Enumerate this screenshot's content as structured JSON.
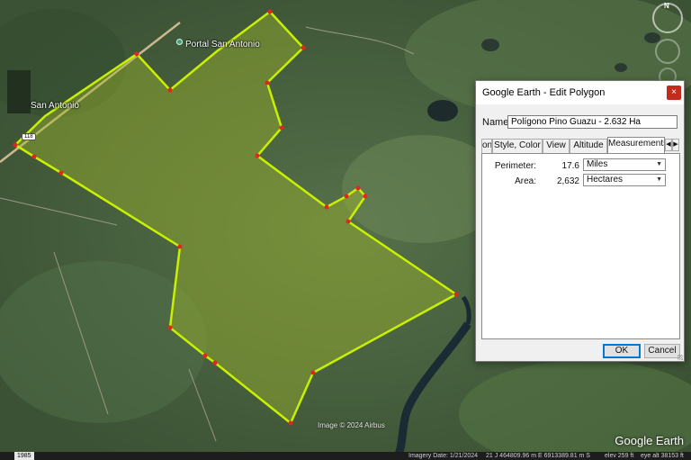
{
  "map": {
    "place_labels": {
      "town": "San Antonio",
      "poi": "Portal San Antonio"
    },
    "route_shield": "118",
    "imagery_credit": "Image © 2024 Airbus",
    "brand": "Google Earth",
    "compass_north": "N",
    "colors": {
      "polygon_fill": "#9fb82a",
      "polygon_outline": "#c8f000",
      "vertex": "#e3261b"
    }
  },
  "statusbar": {
    "year": "1985",
    "imagery_date": "Imagery Date: 1/21/2024",
    "coordinates": "21 J 464809.96 m E 6913389.81 m S",
    "elevation": "elev 259 ft",
    "eye_alt": "eye alt 38153 ft"
  },
  "dialog": {
    "title": "Google Earth - Edit Polygon",
    "close_label": "×",
    "name_label": "Name:",
    "name_value": "Polígono Pino Guazu - 2.632 Ha",
    "tabs": [
      {
        "label": "on"
      },
      {
        "label": "Style, Color"
      },
      {
        "label": "View"
      },
      {
        "label": "Altitude"
      },
      {
        "label": "Measurements"
      }
    ],
    "active_tab": "Measurements",
    "tab_scroll_left": "◀",
    "tab_scroll_right": "▶",
    "measurements": {
      "perimeter_label": "Perimeter:",
      "perimeter_value": "17.6",
      "perimeter_unit": "Miles",
      "area_label": "Area:",
      "area_value": "2,632",
      "area_unit": "Hectares"
    },
    "ok_label": "OK",
    "cancel_label": "Cancel"
  }
}
